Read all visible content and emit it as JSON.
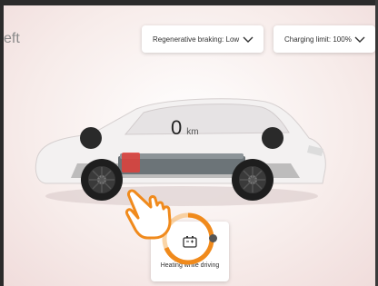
{
  "header": {
    "title_partial": "eft"
  },
  "controls": {
    "regen": {
      "label": "Regenerative braking: Low",
      "icon": "chevron-down-icon"
    },
    "charging": {
      "label": "Charging limit: 100%",
      "icon": "chevron-down-icon"
    }
  },
  "vehicle": {
    "range_value": "0",
    "range_unit": "km",
    "battery_highlight_color": "#e0403a"
  },
  "heating": {
    "label": "Heating while driving",
    "icon": "battery-heating-icon",
    "accent_color": "#f08a1c"
  },
  "pointer": {
    "icon": "tap-hand-icon"
  }
}
